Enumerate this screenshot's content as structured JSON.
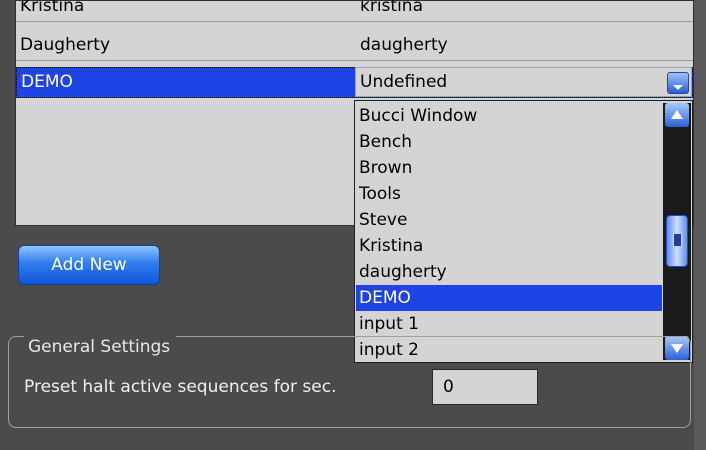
{
  "grid": {
    "rows": [
      {
        "name": "Kristina",
        "value": "kristina"
      },
      {
        "name": "Daugherty",
        "value": "daugherty"
      },
      {
        "name": "DEMO",
        "value": "Undefined"
      }
    ]
  },
  "dropdown": {
    "selected": "Undefined",
    "items": [
      "Bucci Window",
      "Bench",
      "Brown",
      "Tools",
      "Steve",
      "Kristina",
      "daugherty",
      "DEMO",
      "input 1",
      "input 2"
    ],
    "highlighted": "DEMO"
  },
  "buttons": {
    "add_new": "Add New"
  },
  "general_settings": {
    "legend": "General Settings",
    "preset_label": "Preset halt active sequences for sec.",
    "preset_value": "0"
  },
  "colors": {
    "selection": "#1f44e6",
    "panel": "#4b4b4b",
    "grid": "#d4d4d4"
  }
}
